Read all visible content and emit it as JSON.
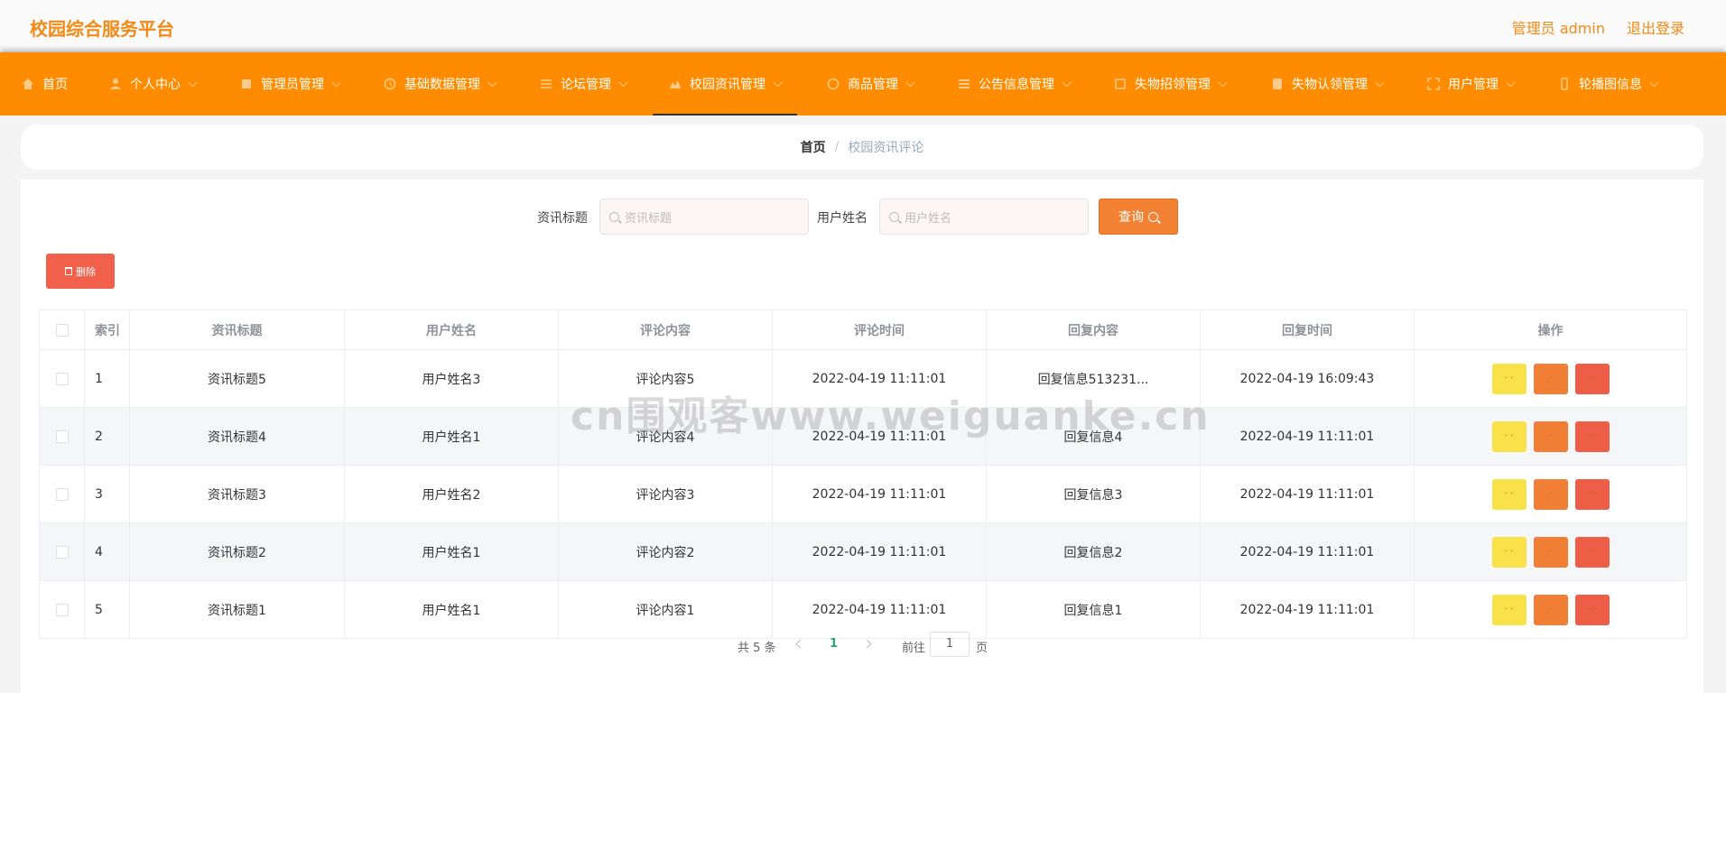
{
  "app": {
    "title": "校园综合服务平台"
  },
  "header": {
    "user_label": "管理员 admin",
    "logout_label": "退出登录"
  },
  "nav": [
    {
      "label": "首页",
      "icon": "home-icon"
    },
    {
      "label": "个人中心",
      "icon": "user-icon"
    },
    {
      "label": "管理员管理",
      "icon": "admin-icon"
    },
    {
      "label": "基础数据管理",
      "icon": "data-icon"
    },
    {
      "label": "论坛管理",
      "icon": "forum-icon"
    },
    {
      "label": "校园资讯管理",
      "icon": "news-icon"
    },
    {
      "label": "商品管理",
      "icon": "goods-icon"
    },
    {
      "label": "公告信息管理",
      "icon": "notice-icon"
    },
    {
      "label": "失物招领管理",
      "icon": "lost-icon"
    },
    {
      "label": "失物认领管理",
      "icon": "claim-icon"
    },
    {
      "label": "用户管理",
      "icon": "users-icon"
    },
    {
      "label": "轮播图信息",
      "icon": "carousel-icon"
    }
  ],
  "breadcrumb": {
    "home": "首页",
    "separator": "/",
    "current": "校园资讯评论"
  },
  "search": {
    "title_label": "资讯标题",
    "title_placeholder": "资讯标题",
    "user_label": "用户姓名",
    "user_placeholder": "用户姓名",
    "query_label": "查询"
  },
  "toolbar": {
    "delete_label": "删除"
  },
  "table": {
    "columns": [
      "索引",
      "资讯标题",
      "用户姓名",
      "评论内容",
      "评论时间",
      "回复内容",
      "回复时间",
      "操作"
    ],
    "rows": [
      [
        "1",
        "资讯标题5",
        "用户姓名3",
        "评论内容5",
        "2022-04-19 11:11:01",
        "回复信息513231...",
        "2022-04-19 16:09:43"
      ],
      [
        "2",
        "资讯标题4",
        "用户姓名1",
        "评论内容4",
        "2022-04-19 11:11:01",
        "回复信息4",
        "2022-04-19 11:11:01"
      ],
      [
        "3",
        "资讯标题3",
        "用户姓名2",
        "评论内容3",
        "2022-04-19 11:11:01",
        "回复信息3",
        "2022-04-19 11:11:01"
      ],
      [
        "4",
        "资讯标题2",
        "用户姓名1",
        "评论内容2",
        "2022-04-19 11:11:01",
        "回复信息2",
        "2022-04-19 11:11:01"
      ],
      [
        "5",
        "资讯标题1",
        "用户姓名1",
        "评论内容1",
        "2022-04-19 11:11:01",
        "回复信息1",
        "2022-04-19 11:11:01"
      ]
    ],
    "action_labels": {
      "detail": "· ·",
      "edit": "·",
      "delete": "· ·"
    }
  },
  "pagination": {
    "total": "共 5 条",
    "current": "1",
    "goto": "前往",
    "goto_value": "1",
    "page_suffix": "页"
  },
  "watermark": "cn围观客www.weiguanke.cn",
  "colors": {
    "brand": "#f28a16",
    "nav_bg": "#ff8c00",
    "query": "#f28133",
    "delete": "#f0604a",
    "op_yellow": "#f9e149",
    "op_orange": "#f07f35",
    "op_red": "#ee5d45",
    "page_active": "#2fa376"
  }
}
